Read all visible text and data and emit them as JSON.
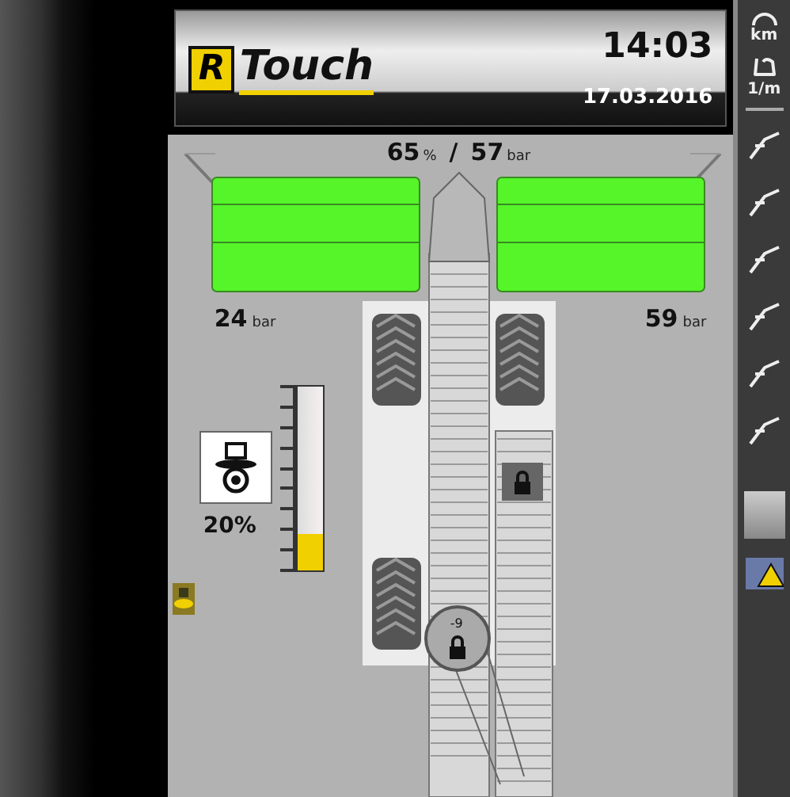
{
  "header": {
    "logo_letter": "R",
    "logo_text": "Touch",
    "time": "14:03",
    "date": "17.03.2016"
  },
  "readout": {
    "percent": "65",
    "percent_unit": "%",
    "separator": "/",
    "pressure": "57",
    "pressure_unit": "bar"
  },
  "left_pressure": {
    "value": "24",
    "unit": "bar"
  },
  "right_pressure": {
    "value": "59",
    "unit": "bar"
  },
  "fill_gauge": {
    "level": 0.2,
    "reading": "20%"
  },
  "boom_joint": {
    "label": "-9"
  },
  "side_menu": [
    {
      "kind": "speed",
      "label": "km"
    },
    {
      "kind": "rate",
      "label": "1/m"
    }
  ]
}
